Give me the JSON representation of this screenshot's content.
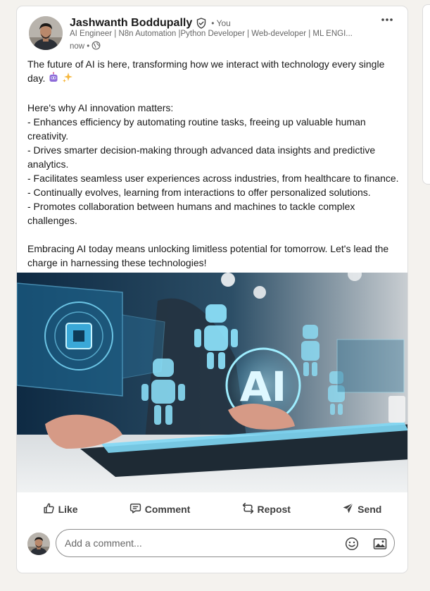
{
  "post": {
    "author": "Jashwanth Boddupally",
    "connection": "• You",
    "headline": "AI Engineer | N8n Automation |Python Developer | Web-developer | ML ENGI...",
    "time": "now •",
    "paragraphs": [
      "The future of AI is here, transforming how we interact with technology every single day.",
      "Here's why AI innovation matters:",
      "- Enhances efficiency by automating routine tasks, freeing up valuable human creativity.",
      "- Drives smarter decision-making through advanced data insights and predictive analytics.",
      "- Facilitates seamless user experiences across industries, from healthcare to finance.",
      "- Continually evolves, learning from interactions to offer personalized solutions.",
      "- Promotes collaboration between humans and machines to tackle complex challenges.",
      "Embracing AI today means unlocking limitless potential for tomorrow. Let's lead the charge in harnessing these technologies!"
    ],
    "image_text": "AI"
  },
  "actions": {
    "like": "Like",
    "comment": "Comment",
    "repost": "Repost",
    "send": "Send"
  },
  "comment_box": {
    "placeholder": "Add a comment..."
  },
  "icons": {
    "verified": "verified-shield-icon",
    "globe": "globe-icon",
    "more": "more-horizontal-icon",
    "like": "thumbs-up-icon",
    "comment": "speech-bubble-icon",
    "repost": "repost-arrows-icon",
    "send": "paper-plane-icon",
    "emoji": "smiley-icon",
    "photo": "image-icon"
  },
  "colors": {
    "page_bg": "#f4f2ee",
    "card_bg": "#ffffff",
    "text_primary": "#191919",
    "text_secondary": "#666666"
  }
}
